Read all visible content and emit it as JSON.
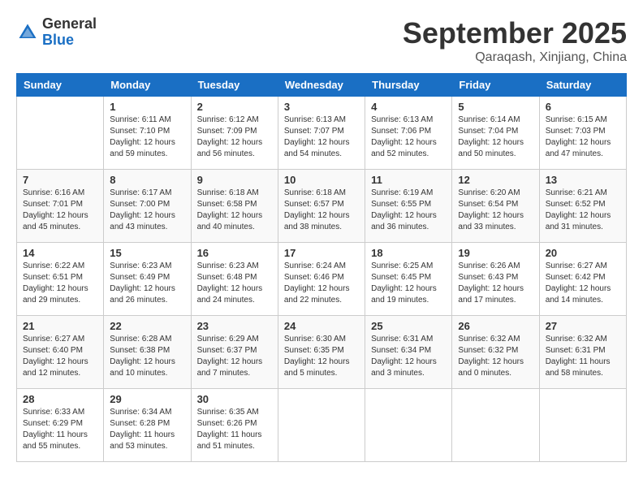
{
  "header": {
    "logo_general": "General",
    "logo_blue": "Blue",
    "title": "September 2025",
    "location": "Qaraqash, Xinjiang, China"
  },
  "calendar": {
    "days_of_week": [
      "Sunday",
      "Monday",
      "Tuesday",
      "Wednesday",
      "Thursday",
      "Friday",
      "Saturday"
    ],
    "weeks": [
      [
        {
          "day": "",
          "info": ""
        },
        {
          "day": "1",
          "info": "Sunrise: 6:11 AM\nSunset: 7:10 PM\nDaylight: 12 hours\nand 59 minutes."
        },
        {
          "day": "2",
          "info": "Sunrise: 6:12 AM\nSunset: 7:09 PM\nDaylight: 12 hours\nand 56 minutes."
        },
        {
          "day": "3",
          "info": "Sunrise: 6:13 AM\nSunset: 7:07 PM\nDaylight: 12 hours\nand 54 minutes."
        },
        {
          "day": "4",
          "info": "Sunrise: 6:13 AM\nSunset: 7:06 PM\nDaylight: 12 hours\nand 52 minutes."
        },
        {
          "day": "5",
          "info": "Sunrise: 6:14 AM\nSunset: 7:04 PM\nDaylight: 12 hours\nand 50 minutes."
        },
        {
          "day": "6",
          "info": "Sunrise: 6:15 AM\nSunset: 7:03 PM\nDaylight: 12 hours\nand 47 minutes."
        }
      ],
      [
        {
          "day": "7",
          "info": "Sunrise: 6:16 AM\nSunset: 7:01 PM\nDaylight: 12 hours\nand 45 minutes."
        },
        {
          "day": "8",
          "info": "Sunrise: 6:17 AM\nSunset: 7:00 PM\nDaylight: 12 hours\nand 43 minutes."
        },
        {
          "day": "9",
          "info": "Sunrise: 6:18 AM\nSunset: 6:58 PM\nDaylight: 12 hours\nand 40 minutes."
        },
        {
          "day": "10",
          "info": "Sunrise: 6:18 AM\nSunset: 6:57 PM\nDaylight: 12 hours\nand 38 minutes."
        },
        {
          "day": "11",
          "info": "Sunrise: 6:19 AM\nSunset: 6:55 PM\nDaylight: 12 hours\nand 36 minutes."
        },
        {
          "day": "12",
          "info": "Sunrise: 6:20 AM\nSunset: 6:54 PM\nDaylight: 12 hours\nand 33 minutes."
        },
        {
          "day": "13",
          "info": "Sunrise: 6:21 AM\nSunset: 6:52 PM\nDaylight: 12 hours\nand 31 minutes."
        }
      ],
      [
        {
          "day": "14",
          "info": "Sunrise: 6:22 AM\nSunset: 6:51 PM\nDaylight: 12 hours\nand 29 minutes."
        },
        {
          "day": "15",
          "info": "Sunrise: 6:23 AM\nSunset: 6:49 PM\nDaylight: 12 hours\nand 26 minutes."
        },
        {
          "day": "16",
          "info": "Sunrise: 6:23 AM\nSunset: 6:48 PM\nDaylight: 12 hours\nand 24 minutes."
        },
        {
          "day": "17",
          "info": "Sunrise: 6:24 AM\nSunset: 6:46 PM\nDaylight: 12 hours\nand 22 minutes."
        },
        {
          "day": "18",
          "info": "Sunrise: 6:25 AM\nSunset: 6:45 PM\nDaylight: 12 hours\nand 19 minutes."
        },
        {
          "day": "19",
          "info": "Sunrise: 6:26 AM\nSunset: 6:43 PM\nDaylight: 12 hours\nand 17 minutes."
        },
        {
          "day": "20",
          "info": "Sunrise: 6:27 AM\nSunset: 6:42 PM\nDaylight: 12 hours\nand 14 minutes."
        }
      ],
      [
        {
          "day": "21",
          "info": "Sunrise: 6:27 AM\nSunset: 6:40 PM\nDaylight: 12 hours\nand 12 minutes."
        },
        {
          "day": "22",
          "info": "Sunrise: 6:28 AM\nSunset: 6:38 PM\nDaylight: 12 hours\nand 10 minutes."
        },
        {
          "day": "23",
          "info": "Sunrise: 6:29 AM\nSunset: 6:37 PM\nDaylight: 12 hours\nand 7 minutes."
        },
        {
          "day": "24",
          "info": "Sunrise: 6:30 AM\nSunset: 6:35 PM\nDaylight: 12 hours\nand 5 minutes."
        },
        {
          "day": "25",
          "info": "Sunrise: 6:31 AM\nSunset: 6:34 PM\nDaylight: 12 hours\nand 3 minutes."
        },
        {
          "day": "26",
          "info": "Sunrise: 6:32 AM\nSunset: 6:32 PM\nDaylight: 12 hours\nand 0 minutes."
        },
        {
          "day": "27",
          "info": "Sunrise: 6:32 AM\nSunset: 6:31 PM\nDaylight: 11 hours\nand 58 minutes."
        }
      ],
      [
        {
          "day": "28",
          "info": "Sunrise: 6:33 AM\nSunset: 6:29 PM\nDaylight: 11 hours\nand 55 minutes."
        },
        {
          "day": "29",
          "info": "Sunrise: 6:34 AM\nSunset: 6:28 PM\nDaylight: 11 hours\nand 53 minutes."
        },
        {
          "day": "30",
          "info": "Sunrise: 6:35 AM\nSunset: 6:26 PM\nDaylight: 11 hours\nand 51 minutes."
        },
        {
          "day": "",
          "info": ""
        },
        {
          "day": "",
          "info": ""
        },
        {
          "day": "",
          "info": ""
        },
        {
          "day": "",
          "info": ""
        }
      ]
    ]
  }
}
